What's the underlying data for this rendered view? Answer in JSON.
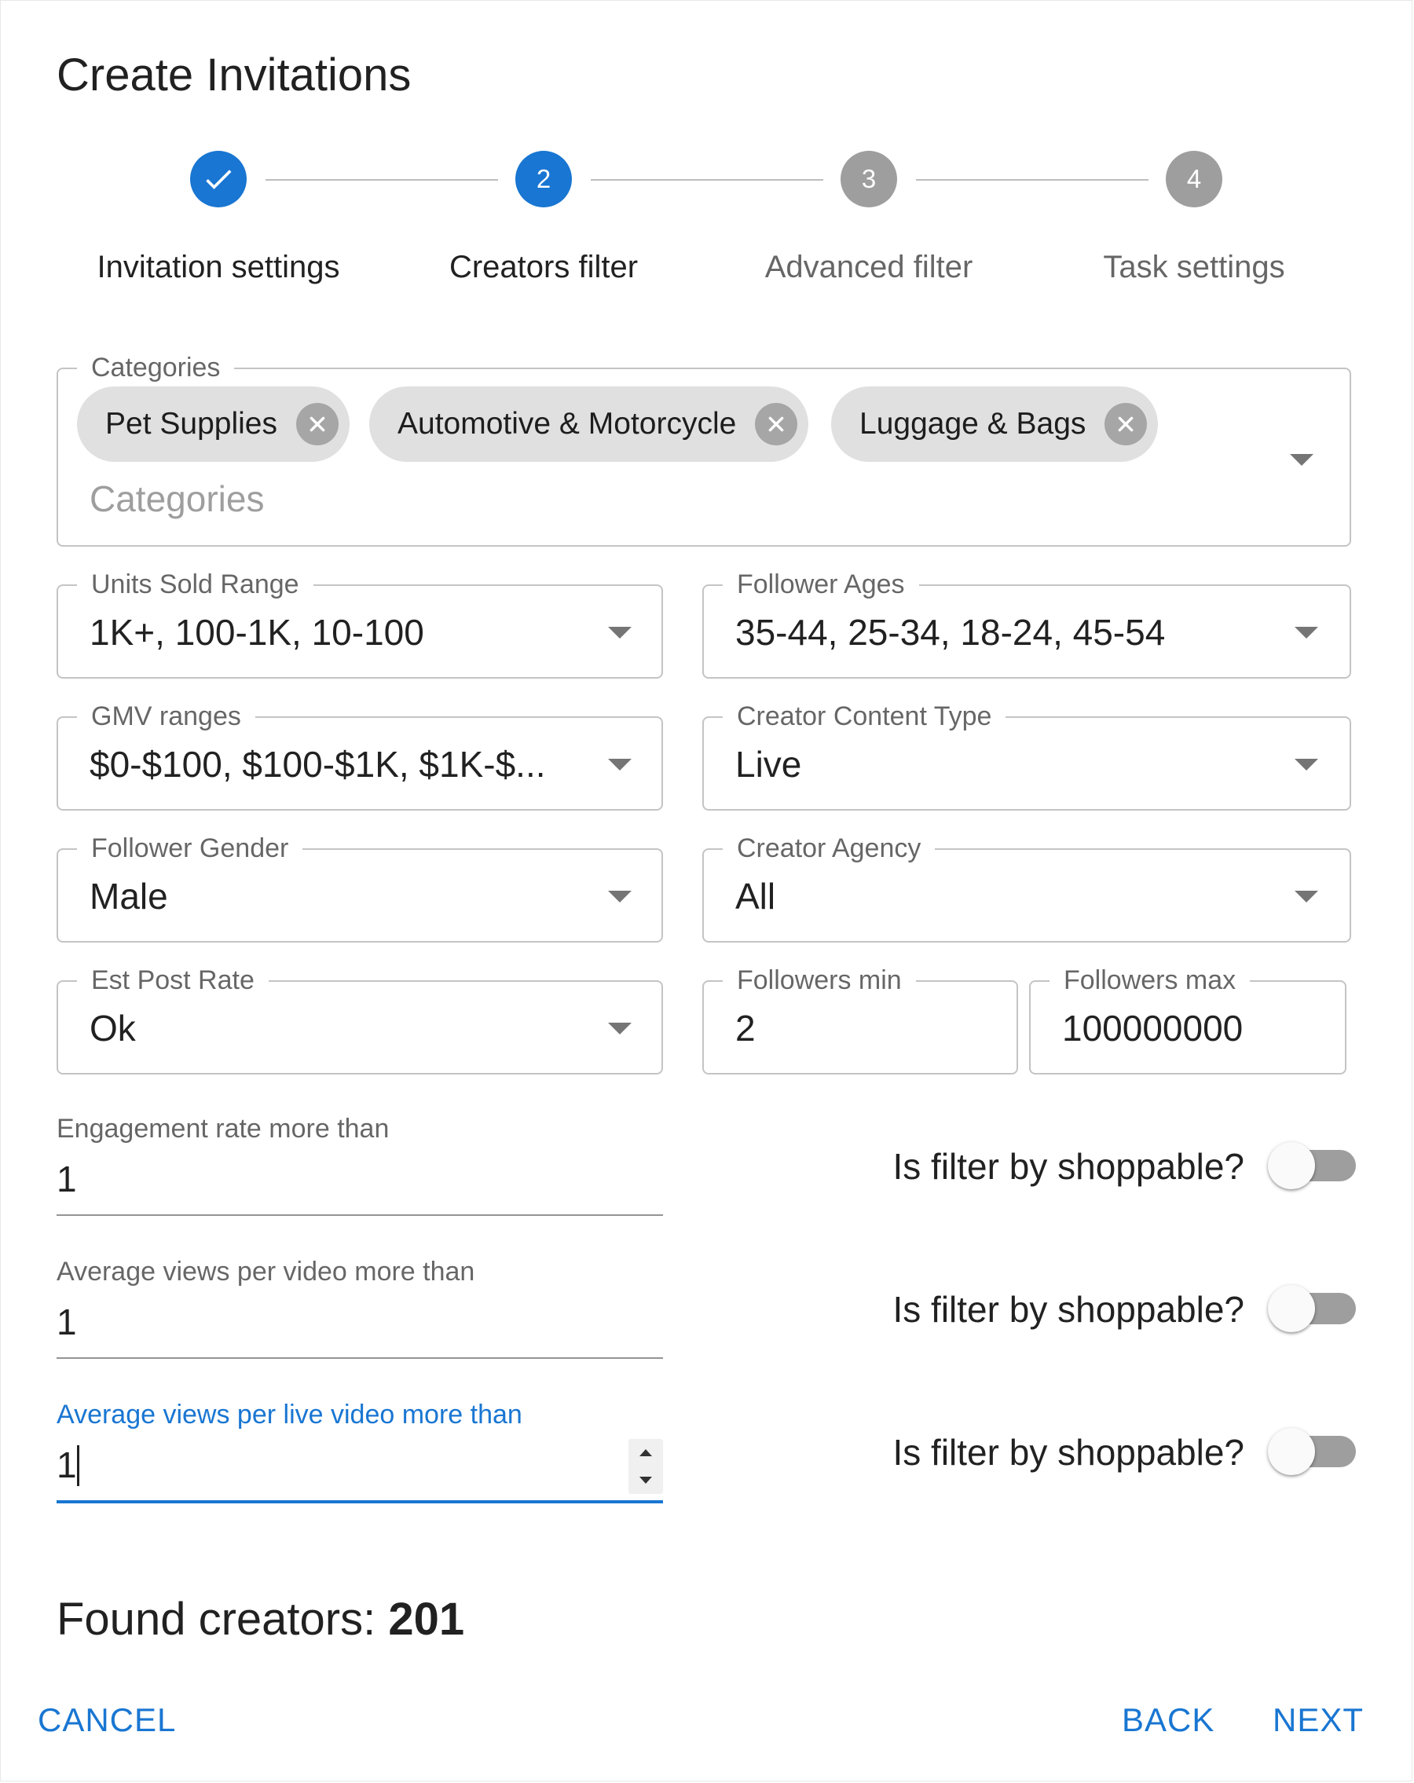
{
  "dialog": {
    "title": "Create Invitations"
  },
  "stepper": {
    "steps": [
      {
        "label": "Invitation settings",
        "number": "",
        "state": "completed"
      },
      {
        "label": "Creators filter",
        "number": "2",
        "state": "active"
      },
      {
        "label": "Advanced filter",
        "number": "3",
        "state": "inactive"
      },
      {
        "label": "Task settings",
        "number": "4",
        "state": "inactive"
      }
    ]
  },
  "categories": {
    "label": "Categories",
    "placeholder": "Categories",
    "selected": [
      "Pet Supplies",
      "Automotive & Motorcycle",
      "Luggage & Bags"
    ]
  },
  "filters": {
    "units_sold": {
      "label": "Units Sold Range",
      "value": "1K+, 100-1K, 10-100"
    },
    "follower_ages": {
      "label": "Follower Ages",
      "value": "35-44, 25-34, 18-24, 45-54"
    },
    "gmv_ranges": {
      "label": "GMV ranges",
      "value": "$0-$100, $100-$1K, $1K-$..."
    },
    "content_type": {
      "label": "Creator Content Type",
      "value": "Live"
    },
    "follower_gender": {
      "label": "Follower Gender",
      "value": "Male"
    },
    "creator_agency": {
      "label": "Creator Agency",
      "value": "All"
    },
    "est_post_rate": {
      "label": "Est Post Rate",
      "value": "Ok"
    },
    "followers_min": {
      "label": "Followers min",
      "value": "2"
    },
    "followers_max": {
      "label": "Followers max",
      "value": "100000000"
    }
  },
  "thresholds": [
    {
      "label": "Engagement rate more than",
      "value": "1",
      "switch_label": "Is filter by shoppable?",
      "switch_on": false,
      "focused": false
    },
    {
      "label": "Average views per video more than",
      "value": "1",
      "switch_label": "Is filter by shoppable?",
      "switch_on": false,
      "focused": false
    },
    {
      "label": "Average views per live video more than",
      "value": "1",
      "switch_label": "Is filter by shoppable?",
      "switch_on": false,
      "focused": true
    }
  ],
  "result": {
    "prefix": "Found creators: ",
    "count": "201"
  },
  "actions": {
    "cancel": "CANCEL",
    "back": "BACK",
    "next": "NEXT"
  },
  "colors": {
    "primary": "#1976d2",
    "step_completed": "#1976d2",
    "step_inactive": "#9e9e9e",
    "chip_bg": "#e0e0e0",
    "switch_track_off": "#9e9e9e",
    "outline": "#c4c4c4"
  },
  "icons": {
    "step_completed": "check-icon",
    "chip_delete": "cancel-circle-icon",
    "select": "arrow-drop-down-icon",
    "number_spin": "spin-arrows-icon"
  }
}
